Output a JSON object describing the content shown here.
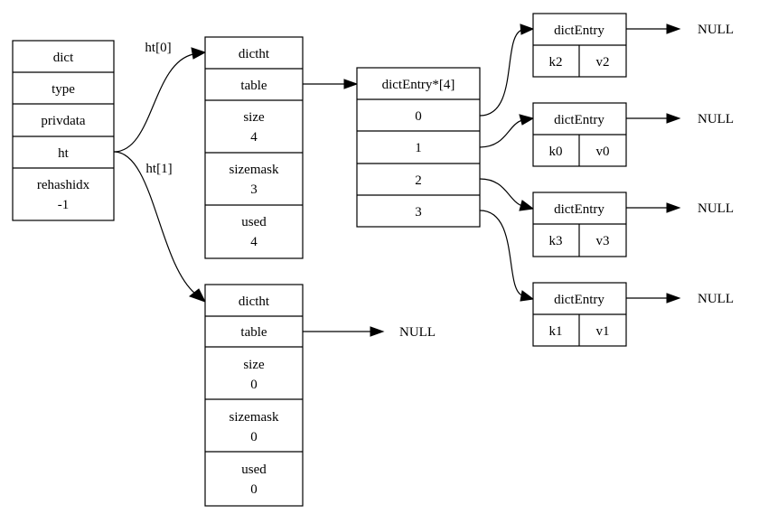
{
  "dict": {
    "rows": [
      "dict",
      "type",
      "privdata",
      "ht",
      "rehashidx",
      "-1"
    ]
  },
  "edge_labels": {
    "ht0": "ht[0]",
    "ht1": "ht[1]"
  },
  "dictht0": {
    "title": "dictht",
    "table": "table",
    "size_label": "size",
    "size": "4",
    "sizemask_label": "sizemask",
    "sizemask": "3",
    "used_label": "used",
    "used": "4"
  },
  "dictht1": {
    "title": "dictht",
    "table": "table",
    "size_label": "size",
    "size": "0",
    "sizemask_label": "sizemask",
    "sizemask": "0",
    "used_label": "used",
    "used": "0",
    "table_target": "NULL"
  },
  "array": {
    "title": "dictEntry*[4]",
    "slots": [
      "0",
      "1",
      "2",
      "3"
    ]
  },
  "entries": [
    {
      "title": "dictEntry",
      "key": "k2",
      "value": "v2",
      "next": "NULL"
    },
    {
      "title": "dictEntry",
      "key": "k0",
      "value": "v0",
      "next": "NULL"
    },
    {
      "title": "dictEntry",
      "key": "k3",
      "value": "v3",
      "next": "NULL"
    },
    {
      "title": "dictEntry",
      "key": "k1",
      "value": "v1",
      "next": "NULL"
    }
  ]
}
